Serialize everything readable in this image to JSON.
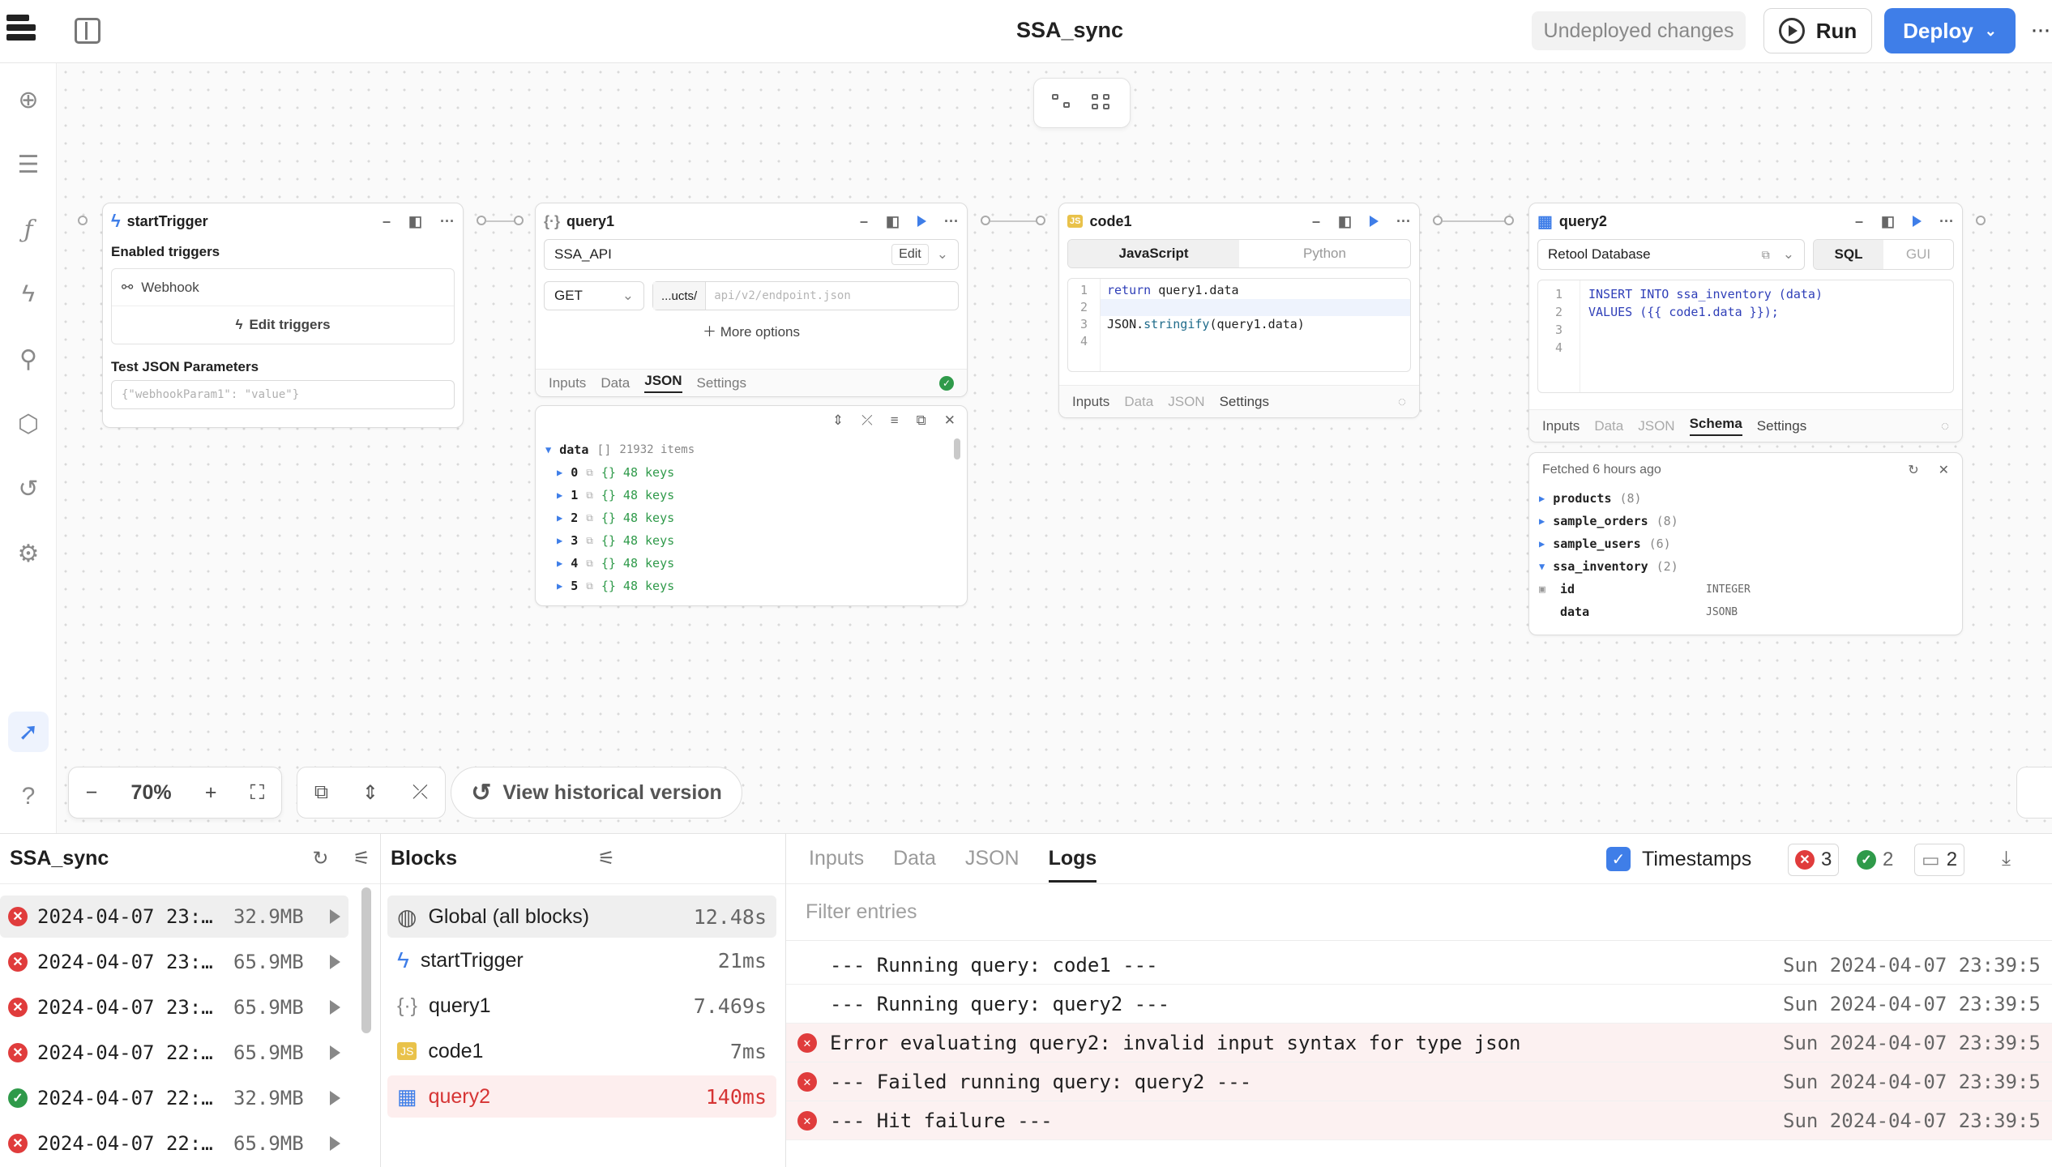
{
  "app": {
    "title": "SSA_sync",
    "undeployed": "Undeployed changes",
    "run_label": "Run",
    "deploy_label": "Deploy"
  },
  "blocks": {
    "startTrigger": {
      "name": "startTrigger",
      "enabled_triggers_label": "Enabled triggers",
      "webhook_label": "Webhook",
      "edit_triggers_label": "Edit triggers",
      "test_params_label": "Test JSON Parameters",
      "test_params_placeholder": "{\"webhookParam1\": \"value\"}"
    },
    "query1": {
      "name": "query1",
      "resource": "SSA_API",
      "edit_label": "Edit",
      "method": "GET",
      "url_prefix": "...ucts/",
      "url_placeholder": "api/v2/endpoint.json",
      "more_options": "More options",
      "tabs": [
        "Inputs",
        "Data",
        "JSON",
        "Settings"
      ],
      "active_tab": "JSON",
      "json_viewer": {
        "root_key": "data",
        "root_type": "[]",
        "root_count": "21932 items",
        "rows": [
          {
            "index": "0",
            "value": "{} 48 keys"
          },
          {
            "index": "1",
            "value": "{} 48 keys"
          },
          {
            "index": "2",
            "value": "{} 48 keys"
          },
          {
            "index": "3",
            "value": "{} 48 keys"
          },
          {
            "index": "4",
            "value": "{} 48 keys"
          },
          {
            "index": "5",
            "value": "{} 48 keys"
          }
        ]
      }
    },
    "code1": {
      "name": "code1",
      "lang_js": "JavaScript",
      "lang_py": "Python",
      "lines": [
        "1",
        "2",
        "3",
        "4"
      ],
      "code_line1_kw": "return",
      "code_line1_rest": "query1.data",
      "code_line3_a": "JSON.",
      "code_line3_fn": "stringify",
      "code_line3_b": "(query1.data)",
      "tabs": [
        "Inputs",
        "Data",
        "JSON",
        "Settings"
      ]
    },
    "query2": {
      "name": "query2",
      "resource": "Retool Database",
      "mode_sql": "SQL",
      "mode_gui": "GUI",
      "lines": [
        "1",
        "2",
        "3",
        "4"
      ],
      "sql_line1": "INSERT INTO ssa_inventory (data)",
      "sql_line2": "VALUES ({{ code1.data }});",
      "tabs": [
        "Inputs",
        "Data",
        "JSON",
        "Schema",
        "Settings"
      ],
      "active_tab": "Schema",
      "schema": {
        "fetched": "Fetched 6 hours ago",
        "tables": [
          {
            "name": "products",
            "count": "(8)"
          },
          {
            "name": "sample_orders",
            "count": "(8)"
          },
          {
            "name": "sample_users",
            "count": "(6)"
          },
          {
            "name": "ssa_inventory",
            "count": "(2)"
          }
        ],
        "columns": [
          {
            "name": "id",
            "type": "INTEGER"
          },
          {
            "name": "data",
            "type": "JSONB"
          }
        ]
      }
    }
  },
  "canvas": {
    "zoom": "70%",
    "history_label": "View historical version"
  },
  "runs_panel": {
    "title": "SSA_sync",
    "runs": [
      {
        "ts": "2024-04-07 23:…",
        "size": "32.9MB",
        "status": "error"
      },
      {
        "ts": "2024-04-07 23:…",
        "size": "65.9MB",
        "status": "error"
      },
      {
        "ts": "2024-04-07 23:…",
        "size": "65.9MB",
        "status": "error"
      },
      {
        "ts": "2024-04-07 22:…",
        "size": "65.9MB",
        "status": "error"
      },
      {
        "ts": "2024-04-07 22:…",
        "size": "32.9MB",
        "status": "success"
      },
      {
        "ts": "2024-04-07 22:…",
        "size": "65.9MB",
        "status": "error"
      }
    ]
  },
  "blocks_panel": {
    "title": "Blocks",
    "rows": [
      {
        "name": "Global (all blocks)",
        "time": "12.48s"
      },
      {
        "name": "startTrigger",
        "time": "21ms"
      },
      {
        "name": "query1",
        "time": "7.469s"
      },
      {
        "name": "code1",
        "time": "7ms"
      },
      {
        "name": "query2",
        "time": "140ms"
      }
    ]
  },
  "logs_panel": {
    "tabs": [
      "Inputs",
      "Data",
      "JSON",
      "Logs"
    ],
    "active_tab": "Logs",
    "timestamps_label": "Timestamps",
    "error_count": "3",
    "success_count": "2",
    "info_count": "2",
    "filter_placeholder": "Filter entries",
    "entries": [
      {
        "msg": "--- Running query: code1 ---",
        "ts": "Sun 2024-04-07 23:39:5",
        "level": "info"
      },
      {
        "msg": "--- Running query: query2 ---",
        "ts": "Sun 2024-04-07 23:39:5",
        "level": "info"
      },
      {
        "msg": "Error evaluating query2: invalid input syntax for type json",
        "ts": "Sun 2024-04-07 23:39:5",
        "level": "error"
      },
      {
        "msg": "--- Failed running query: query2 ---",
        "ts": "Sun 2024-04-07 23:39:5",
        "level": "error"
      },
      {
        "msg": "--- Hit failure ---",
        "ts": "Sun 2024-04-07 23:39:5",
        "level": "error"
      }
    ]
  },
  "colors": {
    "accent": "#3f7ee8",
    "error": "#e03c3c",
    "success": "#2f9a4a"
  }
}
